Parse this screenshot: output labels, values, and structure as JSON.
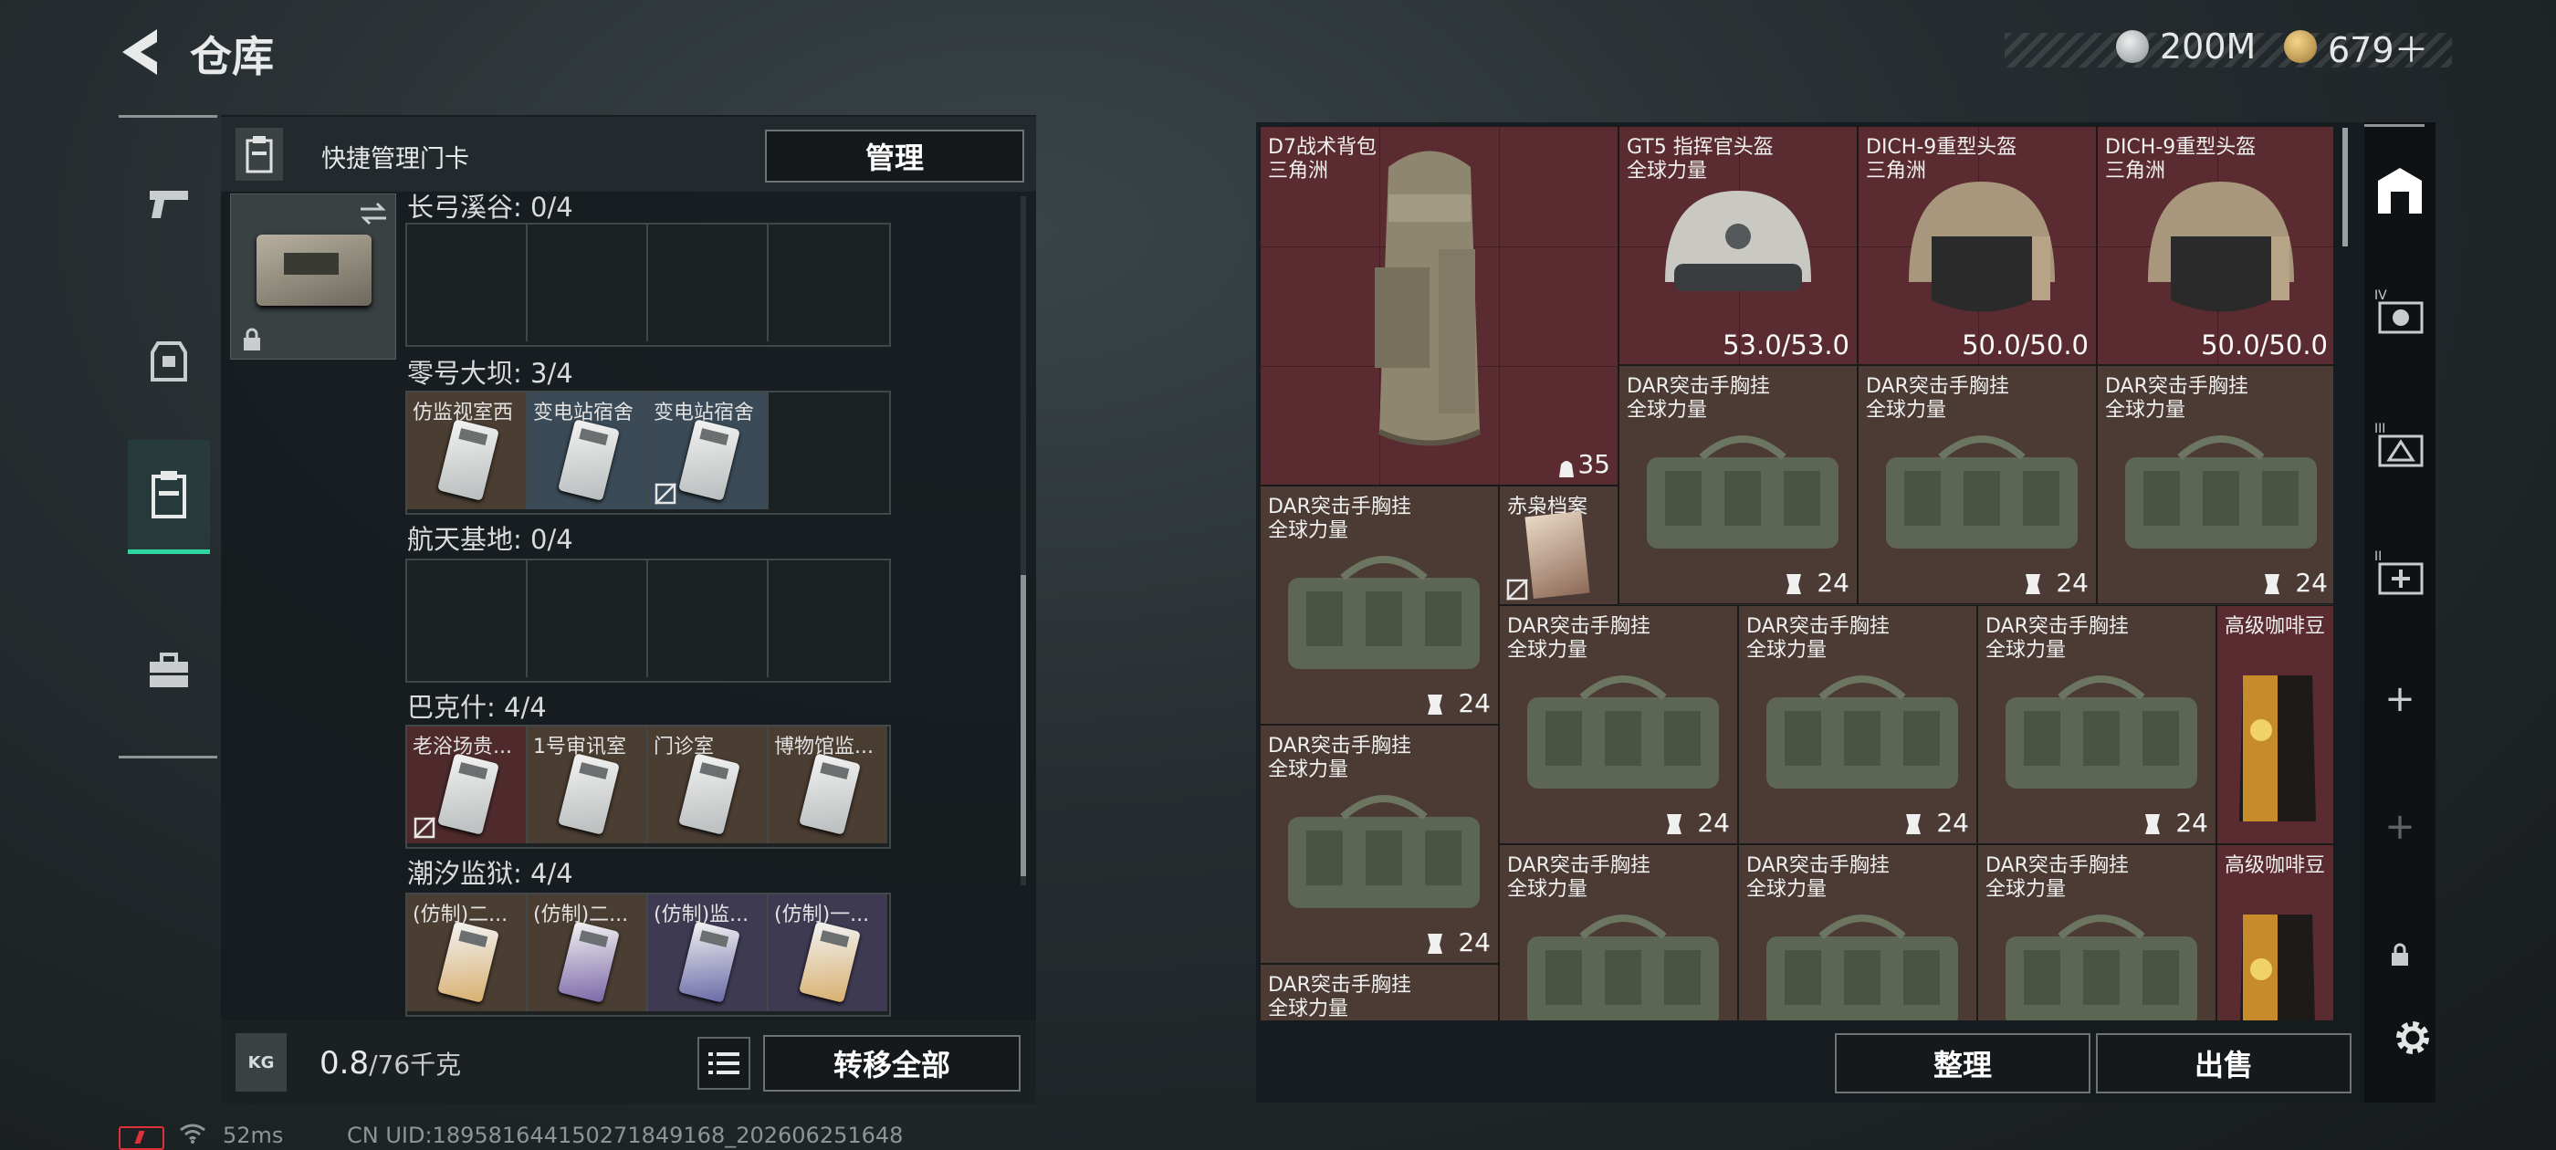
{
  "header": {
    "title": "仓库",
    "currency_silver": "200M",
    "currency_gold": "679＋"
  },
  "left_panel": {
    "header_label": "快捷管理门卡",
    "manage_button": "管理",
    "maps": [
      {
        "label": "长弓溪谷: 0/4",
        "slots": [
          "",
          "",
          "",
          ""
        ]
      },
      {
        "label": "零号大坝: 3/4",
        "slots": [
          "仿监视室西",
          "变电站宿舍",
          "变电站宿舍",
          ""
        ]
      },
      {
        "label": "航天基地: 0/4",
        "slots": [
          "",
          "",
          "",
          ""
        ]
      },
      {
        "label": "巴克什: 4/4",
        "slots": [
          "老浴场贵...",
          "1号审讯室",
          "门诊室",
          "博物馆监..."
        ]
      },
      {
        "label": "潮汐监狱: 4/4",
        "slots": [
          "(仿制)二...",
          "(仿制)二...",
          "(仿制)监...",
          "(仿制)一..."
        ]
      }
    ],
    "weight_value": "0.8",
    "weight_unit": "/76千克",
    "kg_label": "KG",
    "transfer_all_button": "转移全部"
  },
  "inventory": {
    "items": [
      {
        "name": "D7战术背包",
        "sub": "三角洲",
        "count": "35",
        "bg": "red"
      },
      {
        "name": "GT5 指挥官头盔",
        "sub": "全球力量",
        "durability": "53.0/53.0",
        "bg": "red"
      },
      {
        "name": "DICH-9重型头盔",
        "sub": "三角洲",
        "durability": "50.0/50.0",
        "bg": "red"
      },
      {
        "name": "DICH-9重型头盔",
        "sub": "三角洲",
        "durability": "50.0/50.0",
        "bg": "red"
      },
      {
        "name": "DAR突击手胸挂",
        "sub": "全球力量",
        "count": "24",
        "bg": "brown"
      },
      {
        "name": "DAR突击手胸挂",
        "sub": "全球力量",
        "count": "24",
        "bg": "brown"
      },
      {
        "name": "DAR突击手胸挂",
        "sub": "全球力量",
        "count": "24",
        "bg": "brown"
      },
      {
        "name": "DAR突击手胸挂",
        "sub": "全球力量",
        "count": "24",
        "bg": "brown"
      },
      {
        "name": "赤枭档案",
        "sub": "",
        "bg": "brown"
      },
      {
        "name": "DAR突击手胸挂",
        "sub": "全球力量",
        "count": "24",
        "bg": "brown"
      },
      {
        "name": "DAR突击手胸挂",
        "sub": "全球力量",
        "count": "24",
        "bg": "brown"
      },
      {
        "name": "DAR突击手胸挂",
        "sub": "全球力量",
        "count": "24",
        "bg": "brown"
      },
      {
        "name": "高级咖啡豆",
        "sub": "",
        "bg": "red"
      },
      {
        "name": "DAR突击手胸挂",
        "sub": "全球力量",
        "count": "24",
        "bg": "brown"
      },
      {
        "name": "DAR突击手胸挂",
        "sub": "全球力量",
        "bg": "brown"
      },
      {
        "name": "DAR突击手胸挂",
        "sub": "全球力量",
        "bg": "brown"
      },
      {
        "name": "DAR突击手胸挂",
        "sub": "全球力量",
        "bg": "brown"
      },
      {
        "name": "高级咖啡豆",
        "sub": "",
        "bg": "red"
      },
      {
        "name": "DAR突击手胸挂",
        "sub": "全球力量",
        "bg": "brown"
      }
    ],
    "sort_button": "整理",
    "sell_button": "出售"
  },
  "side_tabs": [
    "IV",
    "III",
    "II"
  ],
  "status_bar": {
    "ping": "52ms",
    "uid": "CN UID:18958164415027184916​8_202606251648"
  },
  "colors": {
    "accent": "#2fd6a0",
    "item_red": "#5a2b31",
    "item_brown": "#4b3b34"
  }
}
